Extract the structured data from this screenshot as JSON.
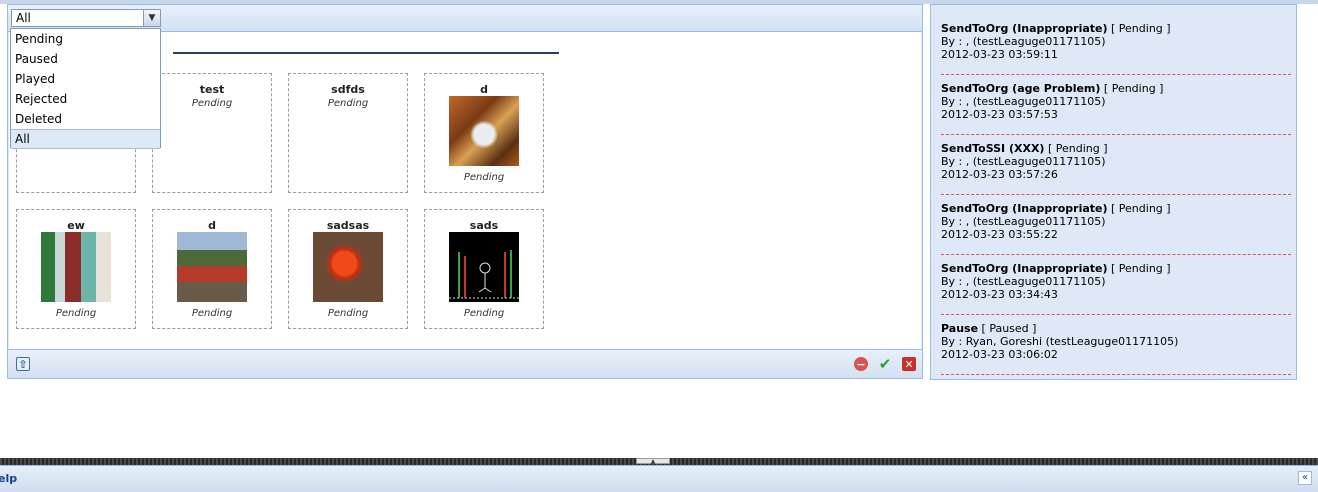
{
  "filter": {
    "value": "All",
    "options": [
      "Pending",
      "Paused",
      "Played",
      "Rejected",
      "Deleted",
      "All"
    ]
  },
  "thumbnails": [
    {
      "title": "",
      "status": "",
      "image": ""
    },
    {
      "title": "test",
      "status": "Pending",
      "image": ""
    },
    {
      "title": "sdfds",
      "status": "Pending",
      "image": ""
    },
    {
      "title": "d",
      "status": "Pending",
      "image": "waterfall-autumn-image"
    },
    {
      "title": "ew",
      "status": "Pending",
      "image": "collage-image"
    },
    {
      "title": "d",
      "status": "Pending",
      "image": "train-image"
    },
    {
      "title": "sadsas",
      "status": "Pending",
      "image": "red-leaf-image"
    },
    {
      "title": "sads",
      "status": "Pending",
      "image": "dark-drawing-image"
    }
  ],
  "history": [
    {
      "action": "SendToOrg (Inappropriate)",
      "state": " [ Pending ]",
      "by": "By : , (testLeaguge01171105)",
      "time": "2012-03-23 03:59:11"
    },
    {
      "action": "SendToOrg (age Problem)",
      "state": " [ Pending ]",
      "by": "By : , (testLeaguge01171105)",
      "time": "2012-03-23 03:57:53"
    },
    {
      "action": "SendToSSI (XXX)",
      "state": " [ Pending ]",
      "by": "By : , (testLeaguge01171105)",
      "time": "2012-03-23 03:57:26"
    },
    {
      "action": "SendToOrg (Inappropriate)",
      "state": " [ Pending ]",
      "by": "By : , (testLeaguge01171105)",
      "time": "2012-03-23 03:55:22"
    },
    {
      "action": "SendToOrg (Inappropriate)",
      "state": " [ Pending ]",
      "by": "By : , (testLeaguge01171105)",
      "time": "2012-03-23 03:34:43"
    },
    {
      "action": "Pause",
      "state": " [ Paused ]",
      "by": "By : Ryan, Goreshi (testLeaguge01171105)",
      "time": "2012-03-23 03:06:02"
    }
  ],
  "footer": {
    "upload_icon": "upload-icon",
    "stop_icon": "stop-icon",
    "approve_icon": "check-icon",
    "reject_icon": "close-icon"
  },
  "bottom": {
    "help_label": "elp"
  },
  "colors": {
    "panel_bg": "#dfe8f6",
    "border": "#99bbe8",
    "divider_red": "#e0505a"
  }
}
